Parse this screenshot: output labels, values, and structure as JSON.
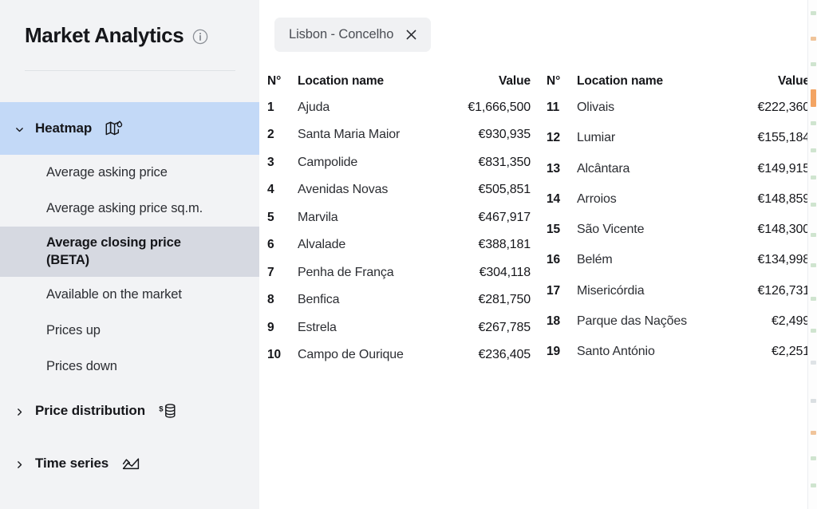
{
  "sidebar": {
    "title": "Market Analytics",
    "info_icon": "info-circle-icon",
    "groups": [
      {
        "label": "Heatmap",
        "icon": "map-heat-icon",
        "expanded": true,
        "chevron": "chevron-down-icon",
        "items": [
          {
            "label": "Average asking price",
            "active": false
          },
          {
            "label": "Average asking price sq.m.",
            "active": false
          },
          {
            "label": "Average closing price (BETA)",
            "active": true
          },
          {
            "label": "Available on the market",
            "active": false
          },
          {
            "label": "Prices up",
            "active": false
          },
          {
            "label": "Prices down",
            "active": false
          }
        ]
      },
      {
        "label": "Price distribution",
        "icon": "coin-stack-dollar-icon",
        "expanded": false,
        "chevron": "chevron-right-icon",
        "items": []
      },
      {
        "label": "Time series",
        "icon": "area-chart-icon",
        "expanded": false,
        "chevron": "chevron-right-icon",
        "items": []
      }
    ]
  },
  "filters": {
    "chips": [
      {
        "label": "Lisbon - Concelho",
        "close_icon": "close-x-icon"
      }
    ]
  },
  "table": {
    "headers": {
      "n": "N°",
      "name": "Location name",
      "value": "Value"
    },
    "left_rows": [
      {
        "n": "1",
        "name": "Ajuda",
        "value": "€1,666,500"
      },
      {
        "n": "2",
        "name": "Santa Maria Maior",
        "value": "€930,935"
      },
      {
        "n": "3",
        "name": "Campolide",
        "value": "€831,350"
      },
      {
        "n": "4",
        "name": "Avenidas Novas",
        "value": "€505,851"
      },
      {
        "n": "5",
        "name": "Marvila",
        "value": "€467,917"
      },
      {
        "n": "6",
        "name": "Alvalade",
        "value": "€388,181"
      },
      {
        "n": "7",
        "name": "Penha de França",
        "value": "€304,118"
      },
      {
        "n": "8",
        "name": "Benfica",
        "value": "€281,750"
      },
      {
        "n": "9",
        "name": "Estrela",
        "value": "€267,785"
      },
      {
        "n": "10",
        "name": "Campo de Ourique",
        "value": "€236,405"
      }
    ],
    "right_rows": [
      {
        "n": "11",
        "name": "Olivais",
        "value": "€222,360"
      },
      {
        "n": "12",
        "name": "Lumiar",
        "value": "€155,184"
      },
      {
        "n": "13",
        "name": "Alcântara",
        "value": "€149,915"
      },
      {
        "n": "14",
        "name": "Arroios",
        "value": "€148,859"
      },
      {
        "n": "15",
        "name": "São Vicente",
        "value": "€148,300"
      },
      {
        "n": "16",
        "name": "Belém",
        "value": "€134,998"
      },
      {
        "n": "17",
        "name": "Misericórdia",
        "value": "€126,731"
      },
      {
        "n": "18",
        "name": "Parque das Nações",
        "value": "€2,499"
      },
      {
        "n": "19",
        "name": "Santo António",
        "value": "€2,251"
      }
    ]
  },
  "colors": {
    "sidebar_bg": "#f2f3f5",
    "group_expanded_bg": "#c3d9f7",
    "subitem_active_bg": "#d6d9e1",
    "chip_bg": "#f0f1f3",
    "text_primary": "#15161a",
    "text_secondary": "#4b4e55",
    "divider": "#dfe2e6"
  }
}
